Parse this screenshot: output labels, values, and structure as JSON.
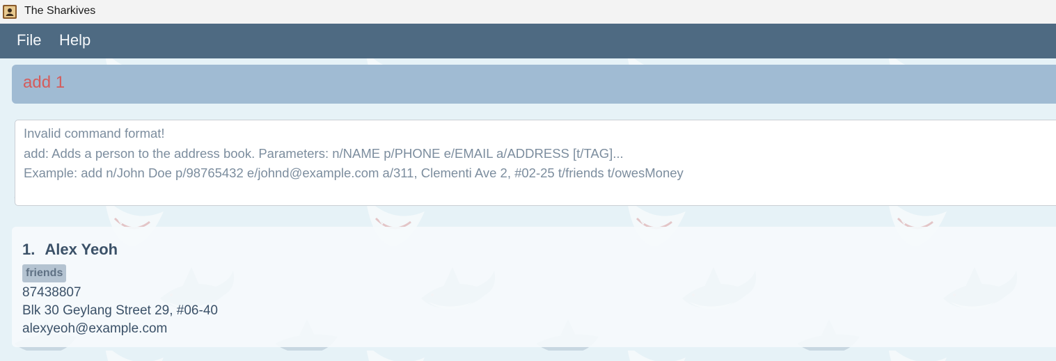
{
  "window": {
    "title": "The Sharkives",
    "icon": "address-book-icon"
  },
  "menu": {
    "items": [
      {
        "label": "File"
      },
      {
        "label": "Help"
      }
    ]
  },
  "command_box": {
    "value": "add 1",
    "value_color": "#d45c5c"
  },
  "result_display": {
    "lines": [
      "Invalid command format!",
      "add: Adds a person to the address book. Parameters: n/NAME p/PHONE e/EMAIL a/ADDRESS [t/TAG]...",
      "Example: add n/John Doe p/98765432 e/johnd@example.com a/311, Clementi Ave 2, #02-25 t/friends t/owesMoney"
    ]
  },
  "person_list": {
    "persons": [
      {
        "index": "1.",
        "name": "Alex Yeoh",
        "tags": [
          "friends"
        ],
        "phone": "87438807",
        "address": "Blk 30 Geylang Street 29, #06-40",
        "email": "alexyeoh@example.com"
      }
    ]
  },
  "colors": {
    "menubar": "#4e6a82",
    "command_box_bg": "#a0bbd3",
    "background": "#e6f2f7",
    "name_text": "#3b5168",
    "tag_bg": "#b4c3d1"
  },
  "background_pattern": "shark-pattern"
}
